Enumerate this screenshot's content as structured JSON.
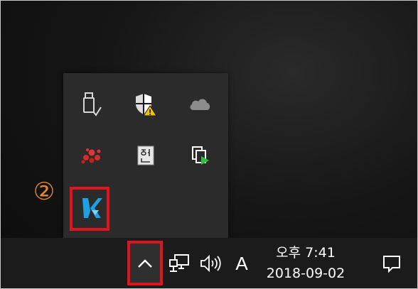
{
  "tray": {
    "icons": [
      "usb-safely-remove-icon",
      "windows-security-warning-icon",
      "onedrive-cloud-icon",
      "red-molecule-app-icon",
      "korean-ime-icon",
      "device-sync-icon",
      "blue-k-app-icon"
    ]
  },
  "annotation": {
    "step": "②"
  },
  "taskbar": {
    "ime_label": "A",
    "clock": {
      "time": "오후 7:41",
      "date": "2018-09-02"
    }
  },
  "colors": {
    "highlight": "#e0141e",
    "step_number": "#e38a2c",
    "taskbar": "#1b1b1b",
    "flyout": "#2b2b2b"
  }
}
